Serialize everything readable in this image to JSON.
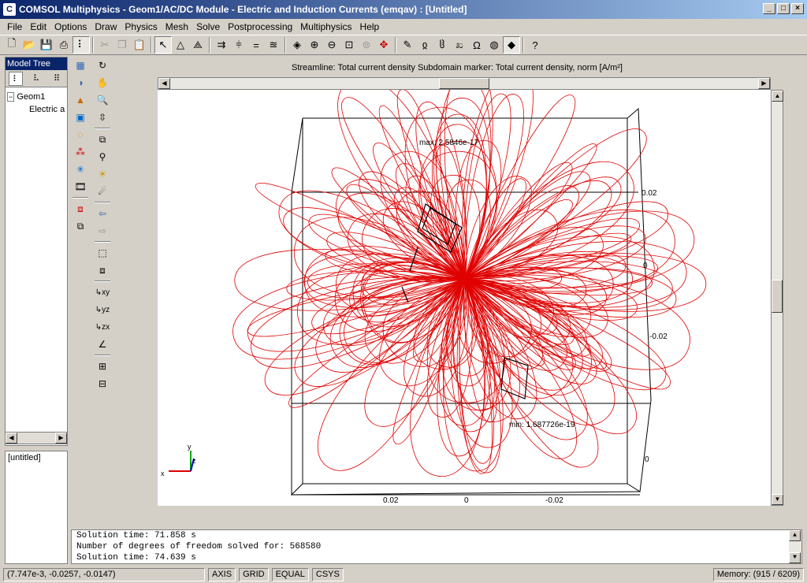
{
  "window": {
    "title": "COMSOL Multiphysics - Geom1/AC/DC Module - Electric and Induction Currents (emqav) : [Untitled]",
    "icon": "comsol-icon"
  },
  "menu": [
    "File",
    "Edit",
    "Options",
    "Draw",
    "Physics",
    "Mesh",
    "Solve",
    "Postprocessing",
    "Multiphysics",
    "Help"
  ],
  "model_tree": {
    "title": "Model Tree",
    "root": "Geom1",
    "child": "Electric a",
    "bottom_label": "[untitled]"
  },
  "plot": {
    "title": "Streamline: Total current density   Subdomain marker: Total current density, norm [A/m²]",
    "max_label": "max: 2.5846e-17",
    "min_label": "min: 1.687726e-19",
    "axis_ticks_right": [
      "0.02",
      "0",
      "-0.02",
      "0"
    ],
    "axis_ticks_bottom": [
      "0.02",
      "0",
      "-0.02"
    ],
    "triad": {
      "x": "x",
      "y": "y",
      "z": "z"
    }
  },
  "console": {
    "lines": [
      "Solution time: 71.858 s",
      "Number of degrees of freedom solved for: 568580",
      "Solution time: 74.639 s"
    ]
  },
  "status": {
    "coords": "(7.747e-3, -0.0257, -0.0147)",
    "axis": "AXIS",
    "grid": "GRID",
    "equal": "EQUAL",
    "csys": "CSYS",
    "memory": "Memory: (915 / 6209)"
  },
  "colors": {
    "streamline": "#e00000",
    "titlebar": "#0a246a"
  }
}
